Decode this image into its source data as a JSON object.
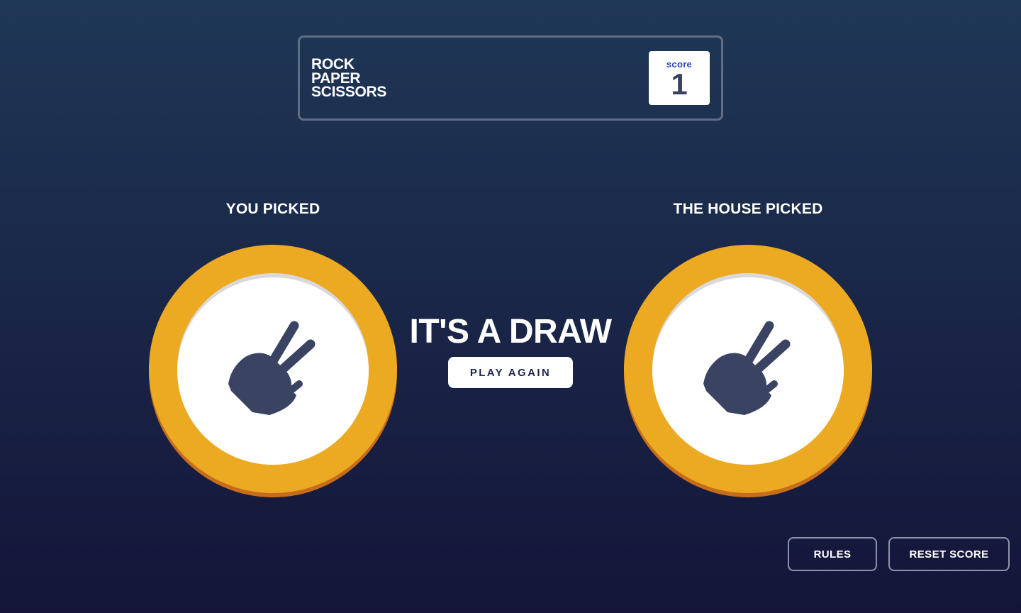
{
  "header": {
    "title_lines": [
      "ROCK",
      "PAPER",
      "SCISSORS"
    ],
    "score_label": "score",
    "score_value": "1"
  },
  "game": {
    "player_label": "YOU PICKED",
    "house_label": "THE HOUSE PICKED",
    "player_pick_icon": "scissors-icon",
    "house_pick_icon": "scissors-icon",
    "result_text": "IT'S A DRAW",
    "play_again_label": "PLAY AGAIN"
  },
  "footer": {
    "rules_label": "RULES",
    "reset_label": "RESET SCORE"
  },
  "colors": {
    "background_top": "#1f3756",
    "background_bottom": "#141539",
    "scissors_ring": "#eca922",
    "scissors_ring_shadow": "#c76c1b",
    "score_label_color": "#2a45c2",
    "score_value_color": "#3b4363",
    "icon_color": "#3b4363",
    "header_border": "#606e85"
  }
}
